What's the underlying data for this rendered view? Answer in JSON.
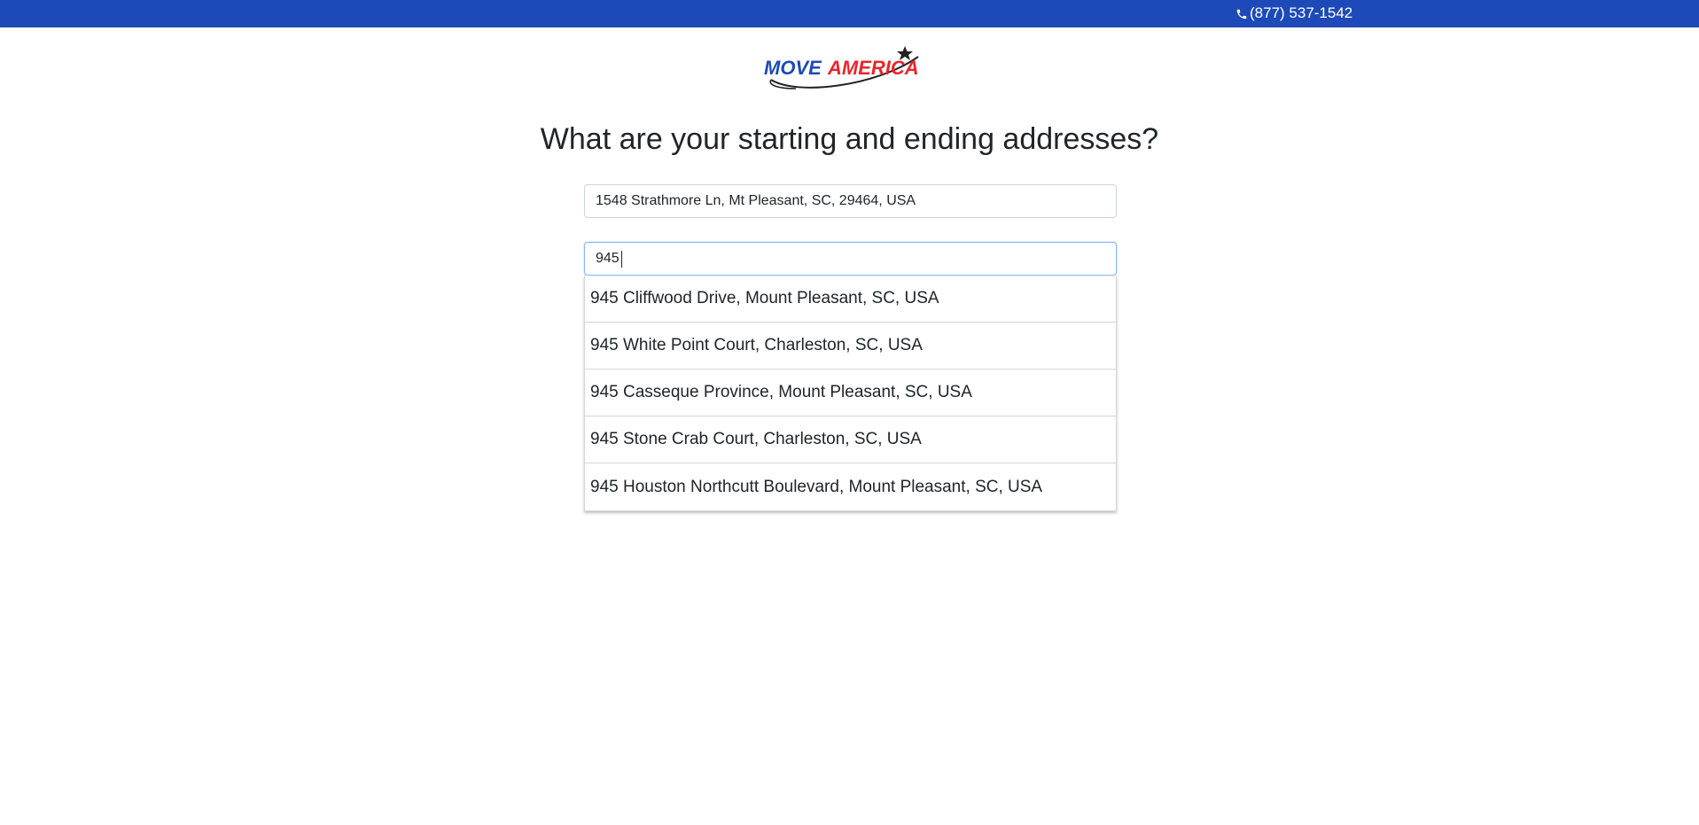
{
  "header": {
    "phone_icon": "phone-icon",
    "phone_number": "(877) 537-1542",
    "background_color": "#1d4ab8"
  },
  "logo": {
    "text_part1": "MOVE",
    "text_part2": "AMERICA",
    "colors": {
      "blue": "#1d4ab8",
      "red": "#e8262b"
    }
  },
  "page": {
    "title": "What are your starting and ending addresses?"
  },
  "form": {
    "start_address": {
      "value": "1548 Strathmore Ln, Mt Pleasant, SC, 29464, USA"
    },
    "end_address": {
      "value": "945"
    }
  },
  "suggestions": [
    {
      "label": "945 Cliffwood Drive, Mount Pleasant, SC, USA"
    },
    {
      "label": "945 White Point Court, Charleston, SC, USA"
    },
    {
      "label": "945 Casseque Province, Mount Pleasant, SC, USA"
    },
    {
      "label": "945 Stone Crab Court, Charleston, SC, USA"
    },
    {
      "label": "945 Houston Northcutt Boulevard, Mount Pleasant, SC, USA"
    }
  ]
}
